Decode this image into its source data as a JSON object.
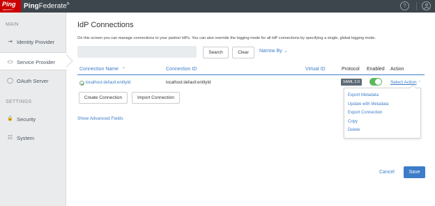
{
  "brand": {
    "logo_text": "Ping",
    "logo_sub": "IDENTITY",
    "name_bold": "Ping",
    "name_light": "Federate",
    "trademark": "®"
  },
  "header": {
    "help_icon": "question-circle-icon",
    "help_glyph": "?",
    "user_icon": "user-circle-icon"
  },
  "sidebar": {
    "main_section": "MAIN",
    "settings_section": "SETTINGS",
    "items": [
      {
        "label": "Identity Provider",
        "icon": "identity-provider-icon",
        "glyph": "⇥"
      },
      {
        "label": "Service Provider",
        "icon": "service-provider-icon",
        "glyph": "▭"
      },
      {
        "label": "OAuth Server",
        "icon": "oauth-icon",
        "glyph": "◯"
      },
      {
        "label": "Security",
        "icon": "lock-icon",
        "glyph": "🔒"
      },
      {
        "label": "System",
        "icon": "sliders-icon",
        "glyph": "☷"
      }
    ]
  },
  "main": {
    "title": "IdP Connections",
    "description": "On this screen you can manage connections to your partner IdPs. You can also override the logging mode for all IdP connections by specifying a single, global logging mode.",
    "search_value": "",
    "search_button": "Search",
    "clear_button": "Clear",
    "narrow_by": "Narrow By",
    "columns": {
      "connection_name": "Connection Name",
      "sort_glyph": "⌃",
      "connection_id": "Connection ID",
      "virtual_id": "Virtual ID",
      "protocol": "Protocol",
      "enabled": "Enabled",
      "action": "Action"
    },
    "rows": [
      {
        "connection_name": "localhost:default:entityId",
        "connection_id": "localhost:default:entityId",
        "virtual_id": "",
        "protocol": "SAML 2.0",
        "enabled": true,
        "action": "Select Action"
      }
    ],
    "create_connection": "Create Connection",
    "import_connection": "Import Connection",
    "show_advanced": "Show Advanced Fields",
    "action_menu": [
      "Export Metadata",
      "Update with Metadata",
      "Export Connection",
      "Copy",
      "Delete"
    ],
    "cancel": "Cancel",
    "save": "Save"
  },
  "colors": {
    "topbar": "#3d454d",
    "logo": "#cc0000",
    "accent": "#3d7cc9",
    "toggle_on": "#5cb85c",
    "sidebar": "#eaebec"
  }
}
